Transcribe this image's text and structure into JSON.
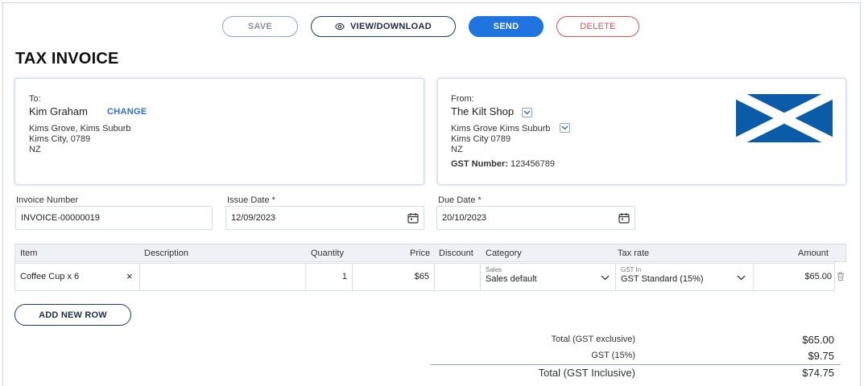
{
  "toolbar": {
    "save_label": "SAVE",
    "view_label": "VIEW/DOWNLOAD",
    "send_label": "SEND",
    "delete_label": "DELETE"
  },
  "page_title": "TAX INVOICE",
  "to": {
    "label": "To:",
    "name": "Kim Graham",
    "change_label": "CHANGE",
    "address": [
      "Kims Grove, Kims Suburb",
      "Kims City, 0789",
      "NZ"
    ]
  },
  "from": {
    "label": "From:",
    "name": "The Kilt Shop",
    "address": [
      "Kims Grove Kims Suburb",
      "Kims City 0789",
      "NZ"
    ],
    "gst_label": "GST Number:",
    "gst_value": "123456789",
    "logo": "scotland-flag"
  },
  "fields": {
    "invoice_number_label": "Invoice Number",
    "invoice_number_value": "INVOICE-00000019",
    "issue_date_label": "Issue Date *",
    "issue_date_value": "12/09/2023",
    "due_date_label": "Due Date *",
    "due_date_value": "20/10/2023"
  },
  "table": {
    "headers": [
      "Item",
      "Description",
      "Quantity",
      "Price",
      "Discount",
      "Category",
      "Tax rate",
      "Amount"
    ],
    "rows": [
      {
        "item": "Coffee Cup x 6",
        "clear": "×",
        "description": "",
        "quantity": "1",
        "price": "$65",
        "discount": "",
        "category_group": "Sales",
        "category": "Sales default",
        "tax_group": "GST In",
        "tax_rate": "GST Standard (15%)",
        "amount": "$65.00"
      }
    ]
  },
  "add_row_label": "ADD NEW ROW",
  "totals": {
    "exclusive_label": "Total (GST exclusive)",
    "exclusive_value": "$65.00",
    "gst_label": "GST (15%)",
    "gst_value": "$9.75",
    "inclusive_label": "Total (GST Inclusive)",
    "inclusive_value": "$74.75"
  },
  "colors": {
    "accent": "#1f74e0",
    "danger": "#d9534f",
    "flag_blue": "#0a5ca8"
  }
}
